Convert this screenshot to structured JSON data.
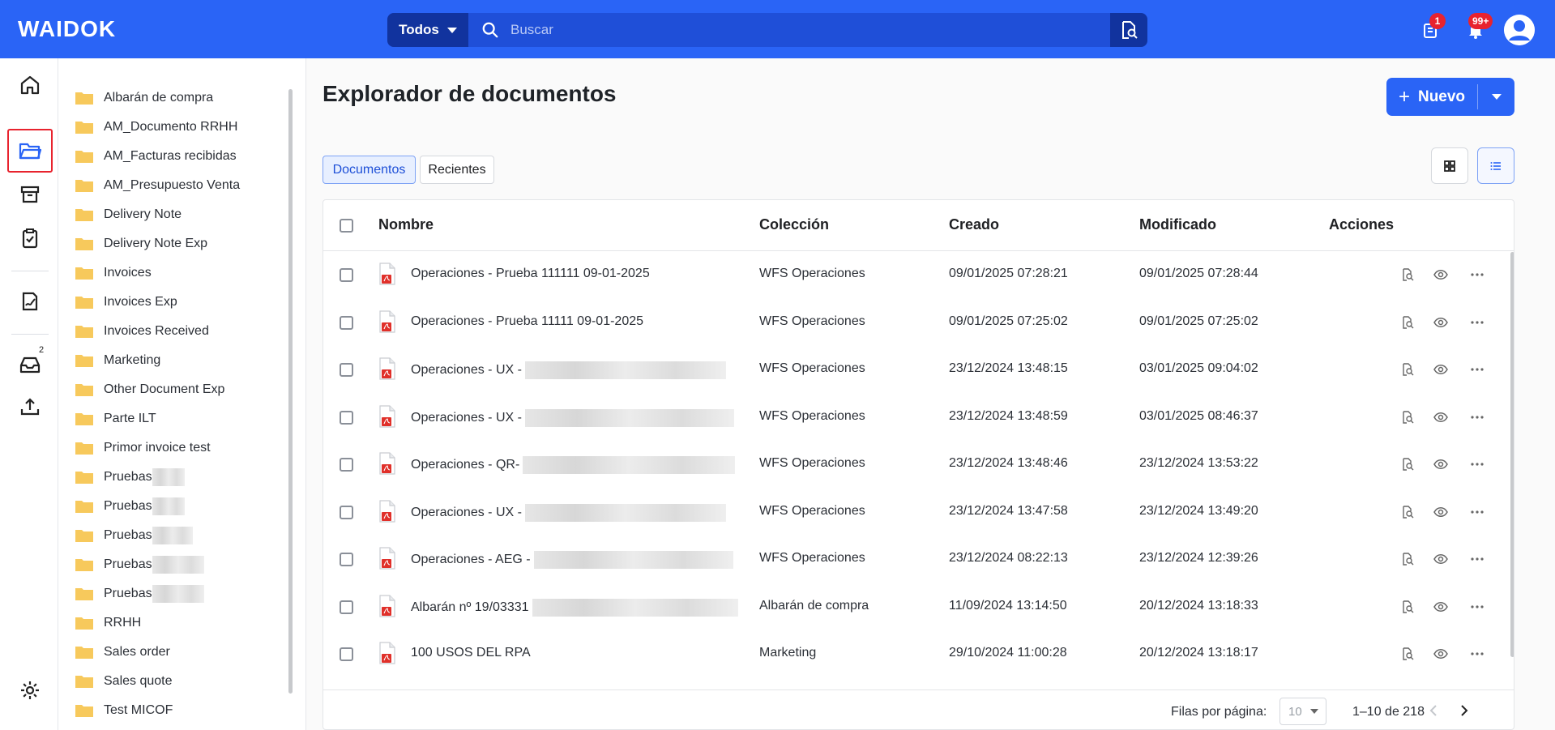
{
  "app": {
    "logo": "WAIDOK"
  },
  "search": {
    "scope": "Todos",
    "placeholder": "Buscar"
  },
  "notifications": {
    "tasks_badge": "1",
    "alerts_badge": "99+"
  },
  "rail": {
    "inbox_badge": "2"
  },
  "folders": [
    {
      "name": "Albarán de compra"
    },
    {
      "name": "AM_Documento RRHH"
    },
    {
      "name": "AM_Facturas recibidas"
    },
    {
      "name": "AM_Presupuesto Venta"
    },
    {
      "name": "Delivery Note"
    },
    {
      "name": "Delivery Note Exp"
    },
    {
      "name": "Invoices"
    },
    {
      "name": "Invoices Exp"
    },
    {
      "name": "Invoices Received"
    },
    {
      "name": "Marketing"
    },
    {
      "name": "Other Document Exp"
    },
    {
      "name": "Parte ILT"
    },
    {
      "name": "Primor invoice test"
    },
    {
      "name": "Pruebas"
    },
    {
      "name": "Pruebas"
    },
    {
      "name": "Pruebas"
    },
    {
      "name": "Pruebas"
    },
    {
      "name": "Pruebas"
    },
    {
      "name": "RRHH"
    },
    {
      "name": "Sales order"
    },
    {
      "name": "Sales quote"
    },
    {
      "name": "Test MICOF"
    }
  ],
  "page": {
    "title": "Explorador de documentos",
    "new_label": "Nuevo"
  },
  "tabs": [
    {
      "label": "Documentos"
    },
    {
      "label": "Recientes"
    }
  ],
  "table": {
    "headers": {
      "name": "Nombre",
      "collection": "Colección",
      "created": "Creado",
      "modified": "Modificado",
      "actions": "Acciones"
    },
    "rows": [
      {
        "name": "Operaciones - Prueba 111111 09-01-2025",
        "collection": "WFS Operaciones",
        "created": "09/01/2025 07:28:21",
        "modified": "09/01/2025 07:28:44"
      },
      {
        "name": "Operaciones - Prueba 11111 09-01-2025",
        "collection": "WFS Operaciones",
        "created": "09/01/2025 07:25:02",
        "modified": "09/01/2025 07:25:02"
      },
      {
        "name": "Operaciones - UX -",
        "collection": "WFS Operaciones",
        "created": "23/12/2024 13:48:15",
        "modified": "03/01/2025 09:04:02"
      },
      {
        "name": "Operaciones - UX -",
        "collection": "WFS Operaciones",
        "created": "23/12/2024 13:48:59",
        "modified": "03/01/2025 08:46:37"
      },
      {
        "name": "Operaciones - QR-",
        "collection": "WFS Operaciones",
        "created": "23/12/2024 13:48:46",
        "modified": "23/12/2024 13:53:22"
      },
      {
        "name": "Operaciones - UX -",
        "collection": "WFS Operaciones",
        "created": "23/12/2024 13:47:58",
        "modified": "23/12/2024 13:49:20"
      },
      {
        "name": "Operaciones - AEG -",
        "collection": "WFS Operaciones",
        "created": "23/12/2024 08:22:13",
        "modified": "23/12/2024 12:39:26"
      },
      {
        "name": "Albarán nº 19/03331",
        "collection": "Albarán de compra",
        "created": "11/09/2024 13:14:50",
        "modified": "20/12/2024 13:18:33"
      },
      {
        "name": "100 USOS DEL RPA",
        "collection": "Marketing",
        "created": "29/10/2024 11:00:28",
        "modified": "20/12/2024 13:18:17"
      }
    ]
  },
  "footer": {
    "rows_per_page_label": "Filas por página:",
    "rows_per_page": "10",
    "range": "1–10 de 218"
  },
  "colors": {
    "brand": "#2a64f6",
    "badge": "#e8232e",
    "pdf": "#e0302a",
    "folder": "#f7c95c"
  }
}
